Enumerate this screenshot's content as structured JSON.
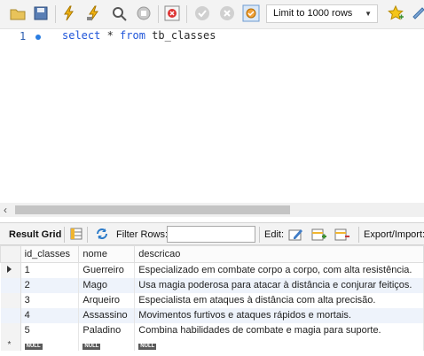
{
  "toolbar": {
    "limit_select": "Limit to 1000 rows",
    "icons": [
      "open-folder-icon",
      "save-icon",
      "execute-lightning-icon",
      "execute-current-lightning-icon",
      "explain-magnifier-icon",
      "stop-icon",
      "toggle-error-icon",
      "commit-icon",
      "rollback-icon",
      "autocommit-icon",
      "limit-dropdown",
      "bookmark-star-icon",
      "beautify-icon"
    ]
  },
  "editor": {
    "line_number": "1",
    "code_keyword1": "select",
    "code_star": " * ",
    "code_keyword2": "from",
    "code_table": " tb_classes"
  },
  "result_bar": {
    "result_grid": "Result Grid",
    "filter_rows": "Filter Rows:",
    "edit": "Edit:",
    "export_import": "Export/Import:"
  },
  "grid": {
    "columns": [
      "id_classes",
      "nome",
      "descricao"
    ],
    "rows": [
      {
        "id": "1",
        "nome": "Guerreiro",
        "descricao": "Especializado em combate corpo a corpo, com alta resistência."
      },
      {
        "id": "2",
        "nome": "Mago",
        "descricao": "Usa magia poderosa para atacar à distância e conjurar feitiços."
      },
      {
        "id": "3",
        "nome": "Arqueiro",
        "descricao": "Especialista em ataques à distância com alta precisão."
      },
      {
        "id": "4",
        "nome": "Assassino",
        "descricao": "Movimentos furtivos e ataques rápidos e mortais."
      },
      {
        "id": "5",
        "nome": "Paladino",
        "descricao": "Combina habilidades de combate e magia para suporte."
      }
    ],
    "null_label": "NULL",
    "new_row_marker": "*"
  },
  "colors": {
    "keyword": "#1f55d9",
    "row_alt": "#eef3fb",
    "accent": "#2a7de1"
  }
}
